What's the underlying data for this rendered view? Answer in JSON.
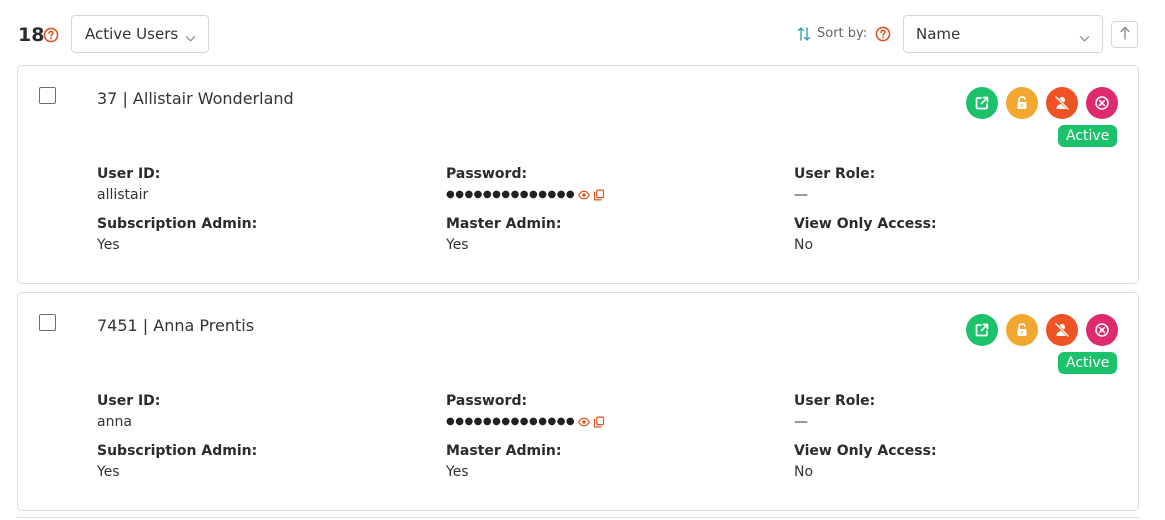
{
  "header": {
    "user_count": "18",
    "filter_value": "Active Users",
    "sort_label": "Sort by:",
    "sort_value": "Name"
  },
  "colors": {
    "accent_orange": "#e0531f",
    "success_green": "#1cc26b",
    "unlock_amber": "#f2a730",
    "deactivate_red": "#f05323",
    "delete_pink": "#de2a6f",
    "sort_teal": "#3aa0b8"
  },
  "icons": {
    "help": "question-circle-icon",
    "sort": "sort-arrows-icon",
    "sort_direction": "arrow-up-icon",
    "open": "external-link-icon",
    "unlock": "unlock-icon",
    "deactivate": "user-slash-icon",
    "delete": "close-circle-icon",
    "show_password": "eye-icon",
    "copy_password": "copy-icon"
  },
  "users": [
    {
      "title": "37 | Allistair Wonderland",
      "status": "Active",
      "fields": {
        "user_id_label": "User ID:",
        "user_id": "allistair",
        "password_label": "Password:",
        "password_masked": "●●●●●●●●●●●●●●",
        "user_role_label": "User Role:",
        "user_role": "—",
        "subscription_admin_label": "Subscription Admin:",
        "subscription_admin": "Yes",
        "master_admin_label": "Master Admin:",
        "master_admin": "Yes",
        "view_only_label": "View Only Access:",
        "view_only": "No"
      }
    },
    {
      "title": "7451 | Anna Prentis",
      "status": "Active",
      "fields": {
        "user_id_label": "User ID:",
        "user_id": "anna",
        "password_label": "Password:",
        "password_masked": "●●●●●●●●●●●●●●",
        "user_role_label": "User Role:",
        "user_role": "—",
        "subscription_admin_label": "Subscription Admin:",
        "subscription_admin": "Yes",
        "master_admin_label": "Master Admin:",
        "master_admin": "Yes",
        "view_only_label": "View Only Access:",
        "view_only": "No"
      }
    }
  ]
}
